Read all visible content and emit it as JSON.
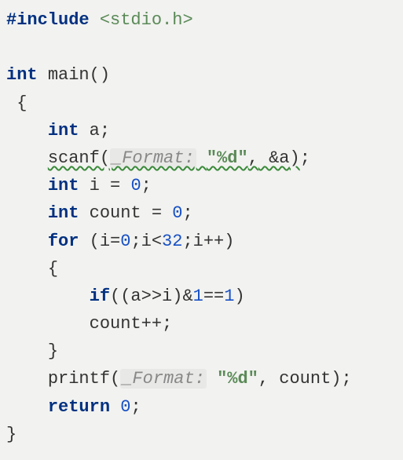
{
  "include": {
    "directive": "#include",
    "path": "<stdio.h>"
  },
  "main_decl": {
    "ret_type": "int",
    "name": "main",
    "parens": "()"
  },
  "braces": {
    "open": "{",
    "close": "}"
  },
  "lines": {
    "decl_a": {
      "type": "int",
      "name": "a",
      "semi": ";"
    },
    "scanf": {
      "fn": "scanf",
      "open": "(",
      "hint": "_Format:",
      "fmt": "\"%d\"",
      "comma": ",",
      "amp": " &a",
      "close": ")",
      "semi": ";"
    },
    "decl_i": {
      "type": "int",
      "name": "i",
      "eq": "=",
      "val": "0",
      "semi": ";"
    },
    "decl_count": {
      "type": "int",
      "name": "count",
      "eq": "=",
      "val": "0",
      "semi": ";"
    },
    "for": {
      "kw": "for",
      "open": " (",
      "init": "i=",
      "init_val": "0",
      "semi1": ";",
      "cond": "i<",
      "cond_val": "32",
      "semi2": ";",
      "inc": "i++",
      "close": ")"
    },
    "if": {
      "kw": "if",
      "open": "((a>>i)&",
      "one": "1",
      "eqeq": "==",
      "one2": "1",
      "close": ")"
    },
    "countpp": {
      "text": "count++",
      "semi": ";"
    },
    "printf": {
      "fn": "printf",
      "open": "(",
      "hint": "_Format:",
      "fmt": "\"%d\"",
      "comma": ",",
      "arg": " count",
      "close": ")",
      "semi": ";"
    },
    "return": {
      "kw": "return",
      "val": "0",
      "semi": ";"
    }
  }
}
